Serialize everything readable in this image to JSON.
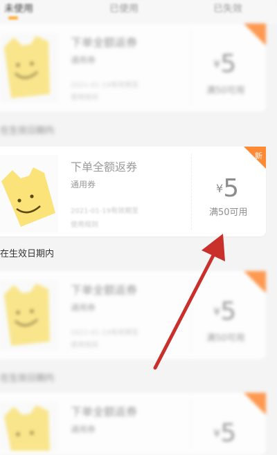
{
  "tabs": [
    {
      "label": "未使用"
    },
    {
      "label": "已使用"
    },
    {
      "label": "已失效"
    }
  ],
  "coupons": [
    {
      "title": "下单全额返券",
      "type": "通用券",
      "date": "2021-01-19有效期至",
      "rule": "使用规则",
      "currency": "¥",
      "amount": "5",
      "condition": "满50可用",
      "badge": "",
      "validity": "在生效日期内"
    },
    {
      "title": "下单全额返券",
      "type": "通用券",
      "date": "2021-01-19有效期至",
      "rule": "使用规则",
      "currency": "¥",
      "amount": "5",
      "condition": "满50可用",
      "badge": "新",
      "validity": "在生效日期内"
    },
    {
      "title": "下单全额返券",
      "type": "通用券",
      "date": "2021-01-19有效期至",
      "rule": "使用规则",
      "currency": "¥",
      "amount": "5",
      "condition": "满50可用",
      "badge": "",
      "validity": "在生效日期内"
    },
    {
      "title": "下单全额返券",
      "type": "通用券",
      "date": "",
      "rule": "",
      "currency": "¥",
      "amount": "5",
      "condition": "",
      "badge": "",
      "validity": ""
    }
  ],
  "colors": {
    "accent": "#ffa31a",
    "badge": "#ff8a34",
    "arrow": "#c9302c",
    "tag": "#fbe37a"
  },
  "icons": {
    "thumbnail": "smiley-tag-icon",
    "pointer": "red-arrow-annotation"
  }
}
